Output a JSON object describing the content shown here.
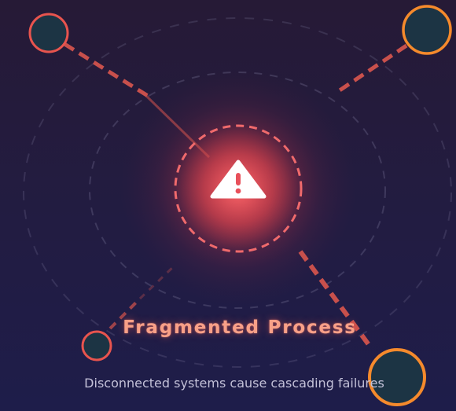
{
  "card": {
    "title": "Fragmented Process",
    "description": "Disconnected systems cause cascading failures",
    "center_icon": "warning-triangle-icon"
  },
  "nodes": [
    {
      "name": "node-top-left",
      "status": "red"
    },
    {
      "name": "node-top-right",
      "status": "orange"
    },
    {
      "name": "node-bottom-left",
      "status": "red"
    },
    {
      "name": "node-bottom-right",
      "status": "orange"
    }
  ],
  "colors": {
    "background_top": "#261a36",
    "background_bottom": "#1e1d4a",
    "node_fill": "#1c3444",
    "node_red": "#e8544e",
    "node_orange": "#f58a2c",
    "alert_glow": "#f24a52",
    "title": "#f8a088",
    "description": "#c3c1d8",
    "dashed_ring": "#8a84a8"
  }
}
